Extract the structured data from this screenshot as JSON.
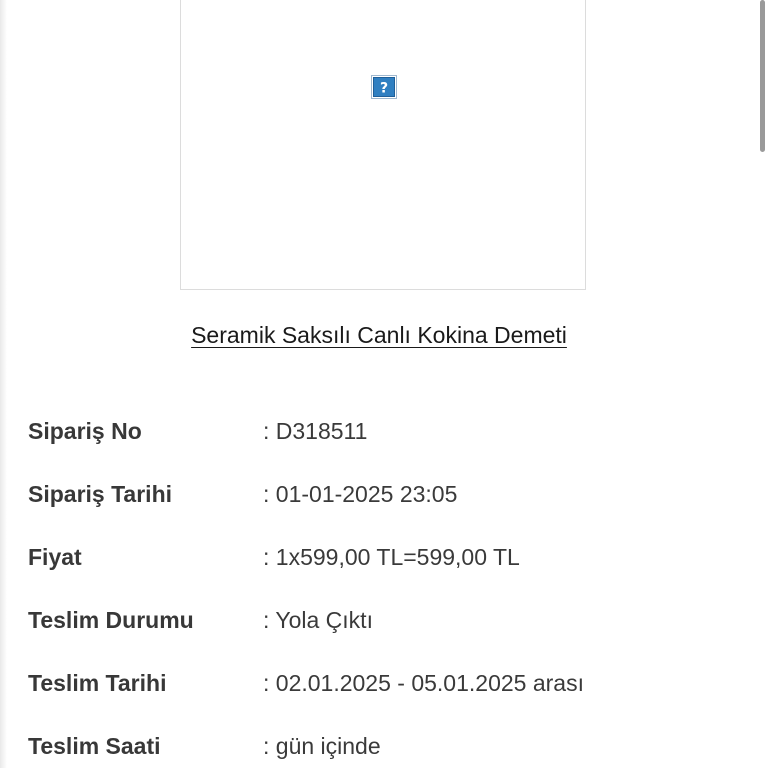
{
  "product": {
    "image_icon": "broken-image-icon",
    "title": "Seramik Saksılı Canlı Kokina Demeti"
  },
  "order_details": [
    {
      "label": "Sipariş No",
      "value": ": D318511"
    },
    {
      "label": "Sipariş Tarihi",
      "value": ": 01-01-2025 23:05"
    },
    {
      "label": "Fiyat",
      "value": ": 1x599,00 TL=599,00 TL"
    },
    {
      "label": "Teslim Durumu",
      "value": ": Yola Çıktı"
    },
    {
      "label": "Teslim Tarihi",
      "value": ": 02.01.2025 - 05.01.2025 arası"
    },
    {
      "label": "Teslim Saati",
      "value": ": gün içinde"
    }
  ],
  "colors": {
    "text": "#333333",
    "border": "#dcdcdc",
    "icon_blue": "#2f7fc1"
  }
}
